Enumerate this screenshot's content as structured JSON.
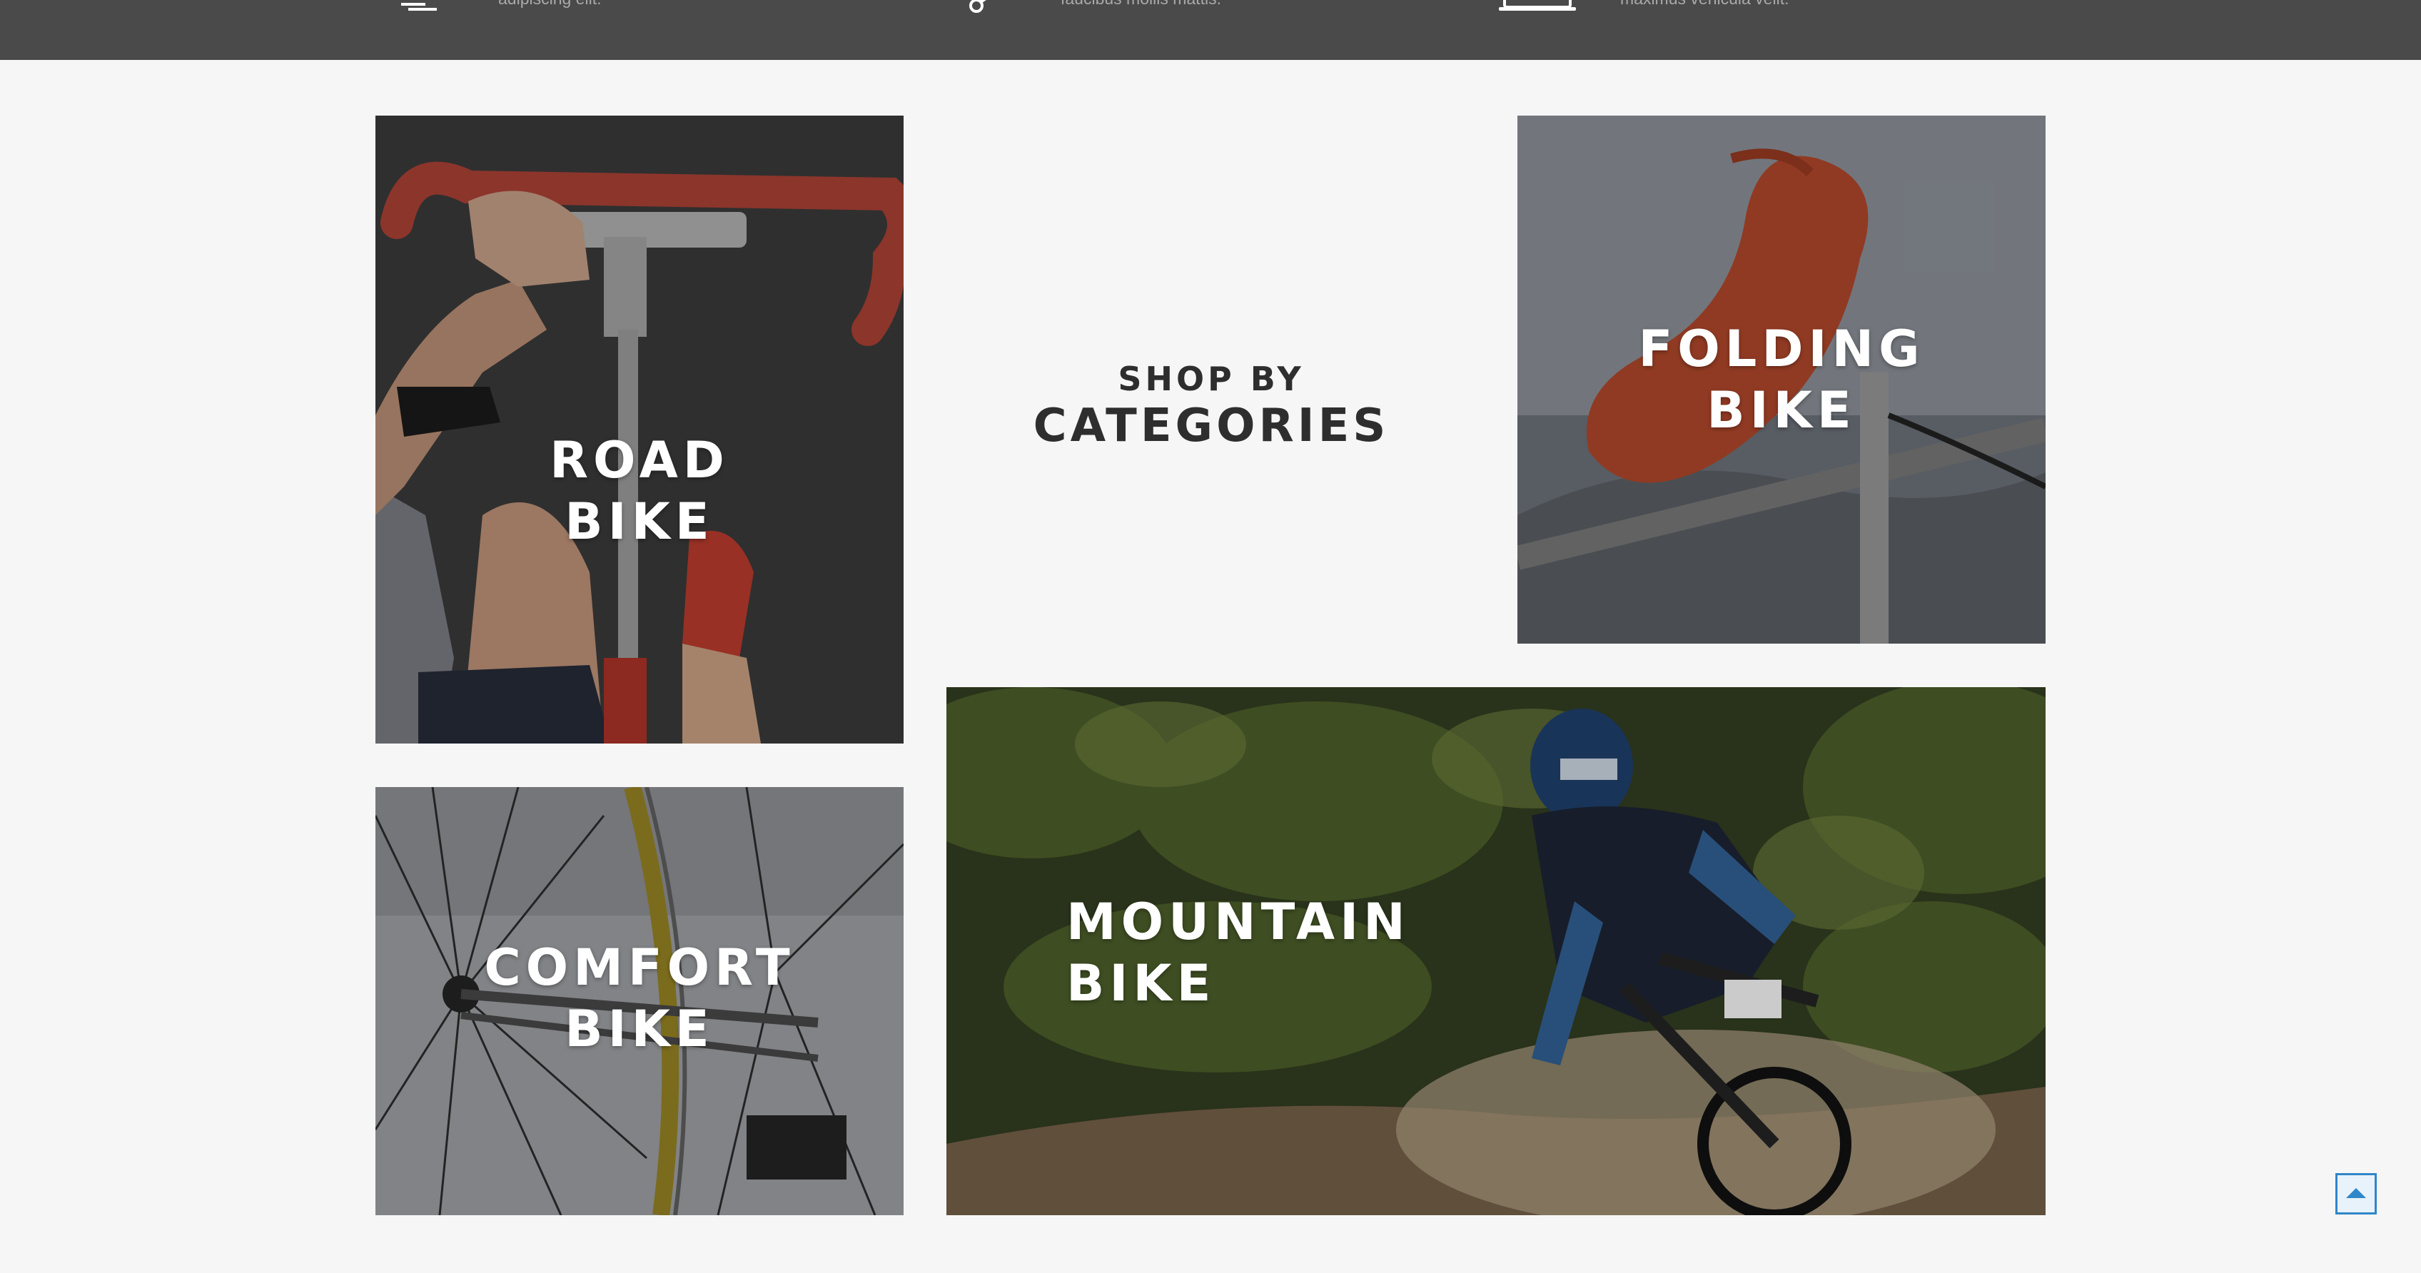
{
  "features": [
    {
      "icon": "fast-delivery-icon",
      "text": "adipiscing elit."
    },
    {
      "icon": "wrench-icon",
      "text": "faucibus mollis mattis."
    },
    {
      "icon": "laptop-icon",
      "text": "maximus vehicula velit."
    }
  ],
  "section": {
    "line1": "SHOP BY",
    "line2": "CATEGORIES"
  },
  "categories": [
    {
      "line1": "ROAD",
      "line2": "BIKE"
    },
    {
      "line1": "FOLDING",
      "line2": "BIKE"
    },
    {
      "line1": "COMFORT",
      "line2": "BIKE"
    },
    {
      "line1": "MOUNTAIN",
      "line2": "BIKE"
    }
  ],
  "back_to_top": {
    "icon": "arrow-up-icon"
  },
  "colors": {
    "topbar": "#4a4a4a",
    "background": "#f6f6f6",
    "accent": "#2f86c8"
  }
}
